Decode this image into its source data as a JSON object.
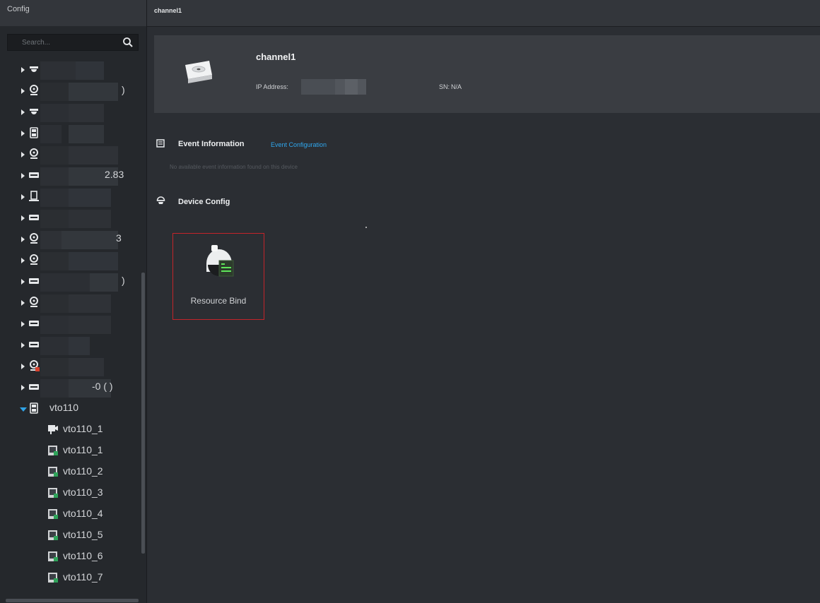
{
  "sidebar": {
    "title": "Config",
    "search_placeholder": "Search...",
    "tree": [
      {
        "icon": "dome-camera-icon",
        "label": ""
      },
      {
        "icon": "webcam-icon",
        "label": ")"
      },
      {
        "icon": "dome-camera-icon",
        "label": ""
      },
      {
        "icon": "intercom-icon",
        "label": ""
      },
      {
        "icon": "webcam-icon",
        "label": ""
      },
      {
        "icon": "nvr-icon",
        "label": "2.83"
      },
      {
        "icon": "access-controller-icon",
        "label": ""
      },
      {
        "icon": "nvr-icon",
        "label": ""
      },
      {
        "icon": "webcam-icon",
        "label": "3"
      },
      {
        "icon": "webcam-icon",
        "label": ""
      },
      {
        "icon": "nvr-icon",
        "label": ")"
      },
      {
        "icon": "webcam-icon",
        "label": ""
      },
      {
        "icon": "nvr-icon",
        "label": ""
      },
      {
        "icon": "nvr-icon",
        "label": ""
      },
      {
        "icon": "webcam-offline-icon",
        "label": ""
      },
      {
        "icon": "nvr-icon",
        "label": "-0 ( )"
      },
      {
        "icon": "intercom-icon",
        "label": "vto110",
        "expanded": true
      }
    ],
    "children": [
      {
        "icon": "video-channel-icon",
        "label": "vto110_1"
      },
      {
        "icon": "door-channel-icon",
        "label": "vto110_1"
      },
      {
        "icon": "door-channel-icon",
        "label": "vto110_2"
      },
      {
        "icon": "door-channel-icon",
        "label": "vto110_3"
      },
      {
        "icon": "door-channel-icon",
        "label": "vto110_4"
      },
      {
        "icon": "door-channel-icon",
        "label": "vto110_5"
      },
      {
        "icon": "door-channel-icon",
        "label": "vto110_6"
      },
      {
        "icon": "door-channel-icon",
        "label": "vto110_7"
      }
    ]
  },
  "main": {
    "tab_title": "channel1",
    "device": {
      "name": "channel1",
      "ip_label": "IP Address:",
      "sn_label": "SN:",
      "sn_value": "N/A"
    },
    "event": {
      "title": "Event Information",
      "config_link": "Event Configuration",
      "empty_text": "No available event information found on this device"
    },
    "device_config": {
      "title": "Device Config",
      "items": [
        {
          "label": "Resource Bind",
          "icon": "resource-bind-icon"
        }
      ]
    }
  },
  "colors": {
    "accent": "#2fa7ee",
    "highlight_border": "#c3242a",
    "background": "#2b2e33"
  }
}
